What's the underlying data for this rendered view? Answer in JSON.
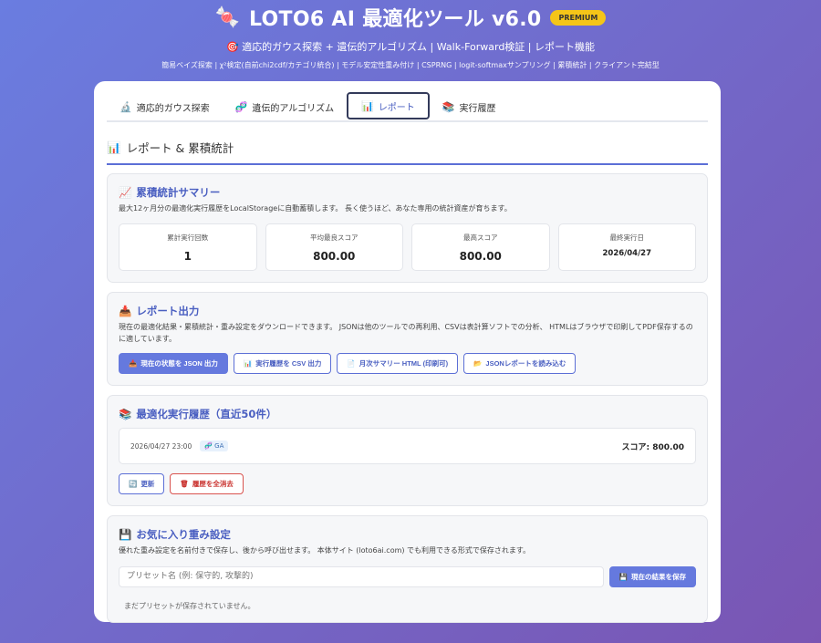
{
  "header": {
    "title": "LOTO6 AI 最適化ツール v6.0",
    "badge": "PREMIUM",
    "subtitle": "🎯 適応的ガウス探索 + 遺伝的アルゴリズム | Walk-Forward検証 | レポート機能",
    "features": "簡易ベイズ探索 | χ²検定(自前chi2cdf/カテゴリ統合) | モデル安定性重み付け | CSPRNG | logit-softmaxサンプリング | 累積統計 | クライアント完結型"
  },
  "tabs": [
    {
      "icon": "🔬",
      "label": "適応的ガウス探索"
    },
    {
      "icon": "🧬",
      "label": "遺伝的アルゴリズム"
    },
    {
      "icon": "📊",
      "label": "レポート"
    },
    {
      "icon": "📚",
      "label": "実行履歴"
    }
  ],
  "section": {
    "icon": "📊",
    "title": "レポート & 累積統計"
  },
  "summary": {
    "icon": "📈",
    "title": "累積統計サマリー",
    "desc": "最大12ヶ月分の最適化実行履歴をLocalStorageに自動蓄積します。 長く使うほど、あなた専用の統計資産が育ちます。",
    "stats": [
      {
        "label": "累計実行回数",
        "value": "1"
      },
      {
        "label": "平均最良スコア",
        "value": "800.00"
      },
      {
        "label": "最高スコア",
        "value": "800.00"
      },
      {
        "label": "最終実行日",
        "value": "2026/04/27"
      }
    ]
  },
  "report": {
    "icon": "📥",
    "title": "レポート出力",
    "desc": "現在の最適化結果・累積統計・重み設定をダウンロードできます。 JSONは他のツールでの再利用、CSVは表計算ソフトでの分析、 HTMLはブラウザで印刷してPDF保存するのに適しています。",
    "buttons": [
      {
        "icon": "📥",
        "label": "現在の状態を JSON 出力"
      },
      {
        "icon": "📊",
        "label": "実行履歴を CSV 出力"
      },
      {
        "icon": "📄",
        "label": "月次サマリー HTML (印刷可)"
      },
      {
        "icon": "📂",
        "label": "JSONレポートを読み込む"
      }
    ]
  },
  "history": {
    "icon": "📚",
    "title": "最適化実行履歴（直近50件）",
    "items": [
      {
        "date": "2026/04/27 23:00",
        "badge": "🧬 GA",
        "score": "スコア: 800.00"
      }
    ],
    "refresh_icon": "🔄",
    "refresh_label": "更新",
    "clear_icon": "🗑",
    "clear_label": "履歴を全消去"
  },
  "favorites": {
    "icon": "💾",
    "title": "お気に入り重み設定",
    "desc": "優れた重み設定を名前付きで保存し、後から呼び出せます。 本体サイト (loto6ai.com) でも利用できる形式で保存されます。",
    "placeholder": "プリセット名 (例: 保守的, 攻撃的)",
    "save_icon": "💾",
    "save_label": "現在の結果を保存",
    "empty": "まだプリセットが保存されていません。"
  },
  "colors": {
    "accent": "#5c6fd6",
    "badge": "#f5c518",
    "danger": "#c9302c"
  }
}
